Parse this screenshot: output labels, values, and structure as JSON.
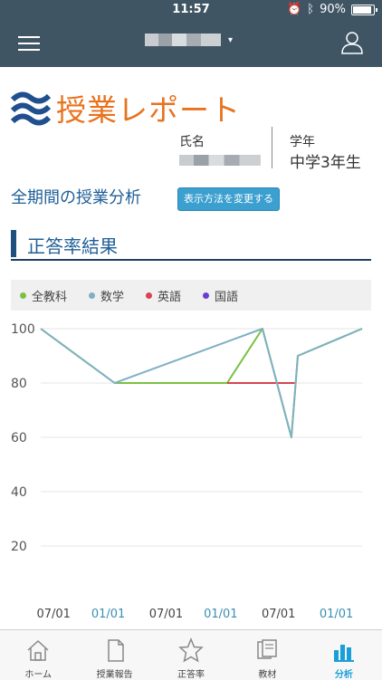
{
  "status": {
    "time": "11:57",
    "battery": "90%",
    "battery_level": 0.9
  },
  "nav": {
    "title_caret": "▾",
    "menu_icon": "hamburger-icon",
    "user_icon": "user-icon"
  },
  "report": {
    "title": "授業レポート",
    "name_label": "氏名",
    "grade_label": "学年",
    "grade_value": "中学3年生"
  },
  "analysis": {
    "title": "全期間の授業分析",
    "change_button": "表示方法を変更する"
  },
  "section": {
    "title": "正答率結果"
  },
  "legend": [
    {
      "label": "全教科",
      "color": "#7bc142"
    },
    {
      "label": "数学",
      "color": "#7fb0c4"
    },
    {
      "label": "英語",
      "color": "#d9434e"
    },
    {
      "label": "国語",
      "color": "#6a3fd0"
    }
  ],
  "chart_data": {
    "type": "line",
    "y_ticks": [
      "100",
      "80",
      "60",
      "40",
      "20"
    ],
    "ylim": [
      0,
      100
    ],
    "x_tick_labels": [
      "07/01",
      "01/01",
      "07/01",
      "01/01",
      "07/01",
      "01/01"
    ],
    "x_tick_colors": [
      "#444444",
      "#3a8fb5",
      "#444444",
      "#3a8fb5",
      "#444444",
      "#3a8fb5"
    ],
    "x_domain": [
      0,
      10
    ],
    "x_tick_positions": [
      0.4,
      2.1,
      3.9,
      5.6,
      7.4,
      9.2
    ],
    "grid": true,
    "series": [
      {
        "name": "全教科",
        "color": "#7bc142",
        "points": [
          [
            0,
            100
          ],
          [
            2.3,
            80
          ],
          [
            5.8,
            80
          ],
          [
            6.9,
            100
          ],
          [
            7.8,
            60
          ],
          [
            8.0,
            90
          ],
          [
            10,
            100
          ]
        ]
      },
      {
        "name": "英語",
        "color": "#d9434e",
        "points": [
          [
            5.8,
            80
          ],
          [
            7.9,
            80
          ]
        ]
      },
      {
        "name": "数学",
        "color": "#7fb0c4",
        "points": [
          [
            0,
            100
          ],
          [
            2.3,
            80
          ],
          [
            6.9,
            100
          ],
          [
            7.8,
            60
          ],
          [
            8.0,
            90
          ],
          [
            10,
            100
          ]
        ]
      }
    ]
  },
  "tabs": [
    {
      "label": "ホーム",
      "icon": "home-icon",
      "active": false
    },
    {
      "label": "授業報告",
      "icon": "document-icon",
      "active": false
    },
    {
      "label": "正答率",
      "icon": "star-icon",
      "active": false
    },
    {
      "label": "教材",
      "icon": "books-icon",
      "active": false
    },
    {
      "label": "分析",
      "icon": "bar-chart-icon",
      "active": true
    }
  ]
}
